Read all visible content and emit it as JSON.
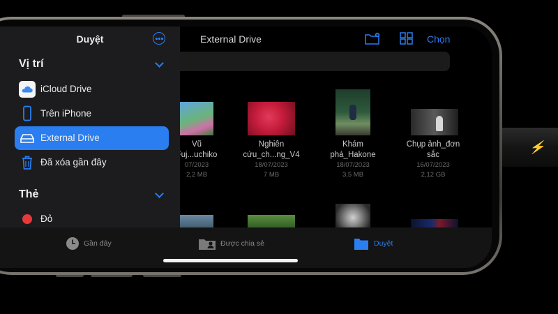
{
  "nav": {
    "title": "External Drive",
    "select_label": "Chọn"
  },
  "sidebar": {
    "title": "Duyệt",
    "locations_header": "Vị trí",
    "locations": [
      {
        "label": "iCloud Drive",
        "icon": "icloud-icon"
      },
      {
        "label": "Trên iPhone",
        "icon": "iphone-icon"
      },
      {
        "label": "External Drive",
        "icon": "external-drive-icon",
        "selected": true
      },
      {
        "label": "Đã xóa gần đây",
        "icon": "trash-icon"
      }
    ],
    "tags_header": "Thẻ",
    "tags": [
      {
        "label": "Đỏ",
        "color": "#e5393b"
      }
    ]
  },
  "files": [
    {
      "name_line1": "Vũ",
      "name_line2": "Fuj...uchiko",
      "date": "07/2023",
      "size": "2,2 MB"
    },
    {
      "name_line1": "Nghiên",
      "name_line2": "cứu_ch...ng_V4",
      "date": "18/07/2023",
      "size": "7 MB"
    },
    {
      "name_line1": "Khám",
      "name_line2": "phá_Hakone",
      "date": "18/07/2023",
      "size": "3,5 MB"
    },
    {
      "name_line1": "Chụp ảnh_đơn",
      "name_line2": "sắc",
      "date": "16/07/2023",
      "size": "2,12 GB"
    }
  ],
  "tabbar": {
    "tabs": [
      {
        "label": "Gần đây",
        "icon": "clock-icon",
        "active": false
      },
      {
        "label": "Được chia sẻ",
        "icon": "shared-folder-icon",
        "active": false
      },
      {
        "label": "Duyệt",
        "icon": "folder-icon",
        "active": true
      }
    ]
  },
  "colors": {
    "accent": "#2a7ef0",
    "sidebar_bg": "#1c1c1e",
    "tag_red": "#e5393b"
  }
}
